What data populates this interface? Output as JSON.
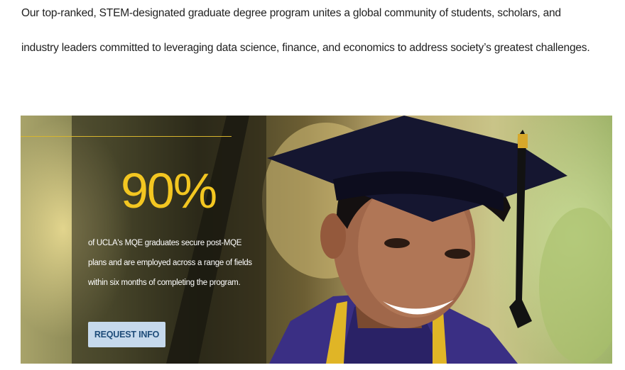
{
  "intro": {
    "line1": "Our top-ranked, STEM-designated graduate degree program unites a global community of students, scholars, and",
    "line2": "industry leaders committed to leveraging data science, finance, and economics to address society’s greatest challenges."
  },
  "hero": {
    "stat_value": "90%",
    "stat_description": "of UCLA's MQE graduates secure post-MQE plans and are employed across a range of fields within six months of completing the program.",
    "button_label": "REQUEST INFO"
  },
  "colors": {
    "accent_gold": "#f3c621",
    "button_bg": "#c6d9ec",
    "button_text": "#1e4c79"
  }
}
